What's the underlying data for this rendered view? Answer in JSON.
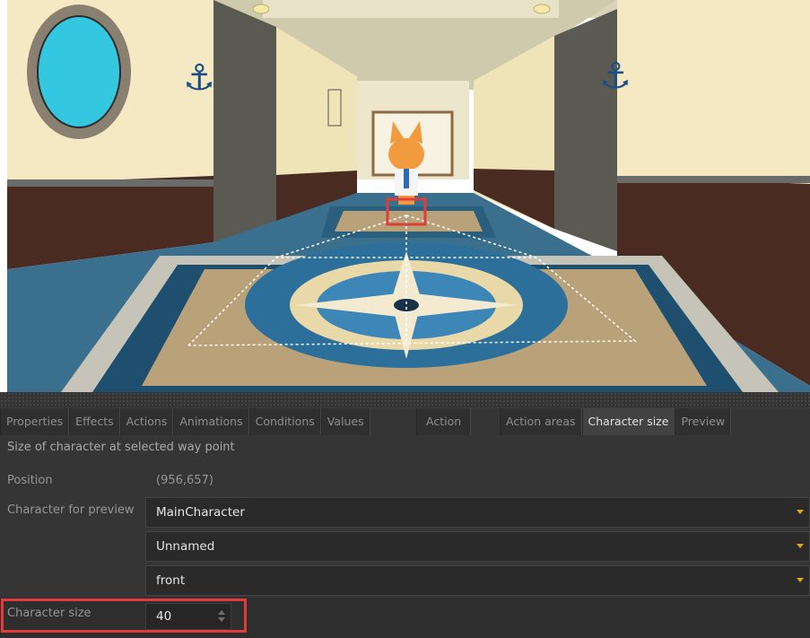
{
  "tabs_left": [
    {
      "label": "Properties",
      "active": false
    },
    {
      "label": "Effects",
      "active": false
    },
    {
      "label": "Actions",
      "active": false
    },
    {
      "label": "Animations",
      "active": false
    },
    {
      "label": "Conditions",
      "active": false
    },
    {
      "label": "Values",
      "active": false
    }
  ],
  "tab_action": {
    "label": "Action",
    "active": false
  },
  "tabs_right": [
    {
      "label": "Action areas",
      "active": false
    },
    {
      "label": "Character size",
      "active": true
    },
    {
      "label": "Preview",
      "active": false
    }
  ],
  "panel": {
    "description": "Size of character at selected way point",
    "position_label": "Position",
    "position_value": "(956,657)",
    "character_label": "Character for preview",
    "character_value": "MainCharacter",
    "outfit_value": "Unnamed",
    "direction_value": "front",
    "size_label": "Character size",
    "size_value": "40"
  },
  "colors": {
    "accent_caret": "#e1a714",
    "highlight": "#e23b3b",
    "panel_bg": "#353535"
  }
}
